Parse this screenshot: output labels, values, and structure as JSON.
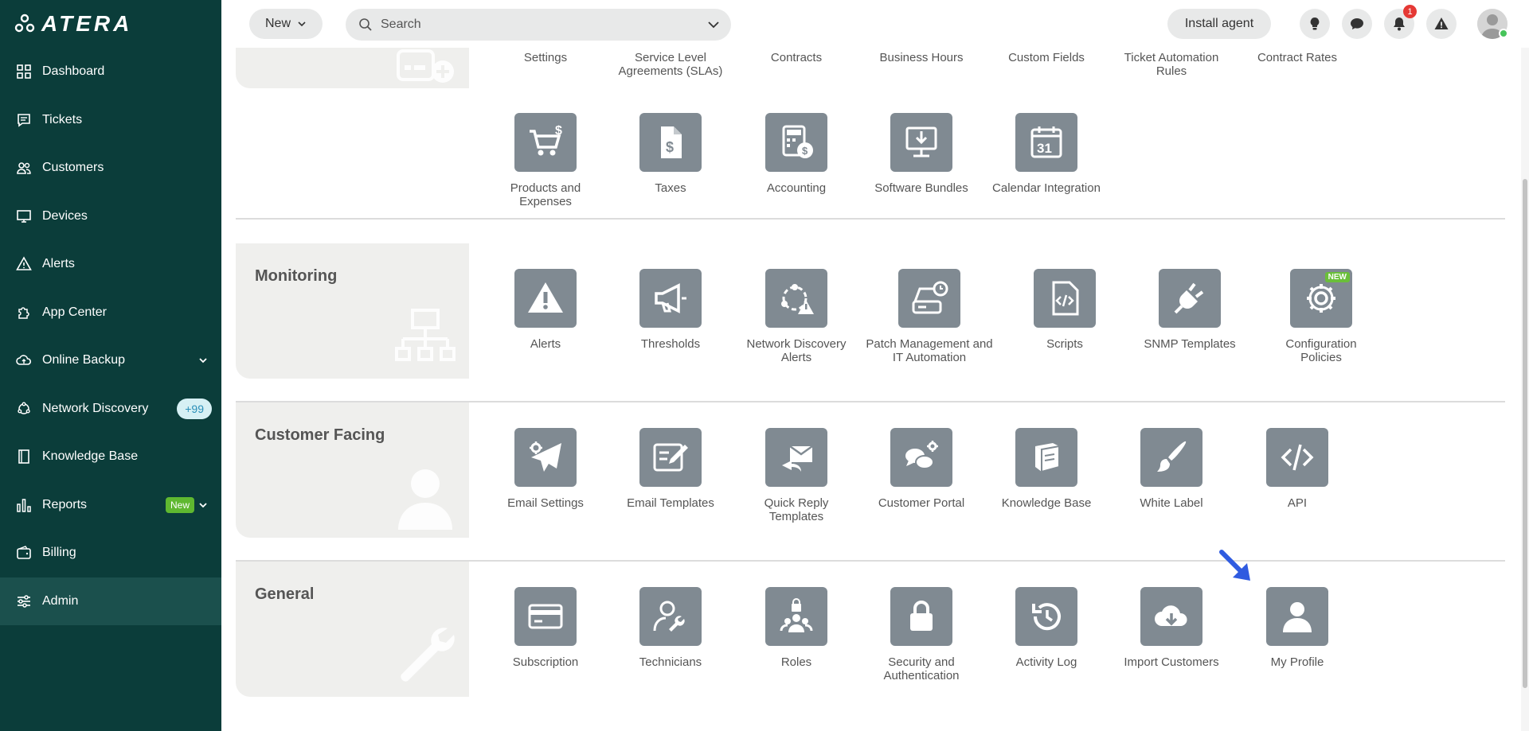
{
  "app": {
    "logo": "ATERA"
  },
  "sidebar": {
    "items": [
      {
        "label": "Dashboard",
        "icon": "dashboard-icon"
      },
      {
        "label": "Tickets",
        "icon": "ticket-icon"
      },
      {
        "label": "Customers",
        "icon": "users-icon"
      },
      {
        "label": "Devices",
        "icon": "monitor-icon"
      },
      {
        "label": "Alerts",
        "icon": "warning-icon"
      },
      {
        "label": "App Center",
        "icon": "puzzle-icon"
      },
      {
        "label": "Online Backup",
        "icon": "cloud-icon"
      },
      {
        "label": "Network Discovery",
        "icon": "network-icon",
        "badge": "+99"
      },
      {
        "label": "Knowledge Base",
        "icon": "book-icon"
      },
      {
        "label": "Reports",
        "icon": "bar-chart-icon",
        "badge": "New"
      },
      {
        "label": "Billing",
        "icon": "wallet-icon"
      },
      {
        "label": "Admin",
        "icon": "sliders-icon",
        "active": true
      }
    ]
  },
  "topbar": {
    "new_label": "New",
    "search_placeholder": "Search",
    "install_label": "Install agent",
    "notification_count": "1"
  },
  "sections": {
    "top_row": [
      "Settings",
      "Service Level Agreements (SLAs)",
      "Contracts",
      "Business Hours",
      "Custom Fields",
      "Ticket Automation Rules",
      "Contract Rates"
    ],
    "billing_row": [
      "Products and Expenses",
      "Taxes",
      "Accounting",
      "Software Bundles",
      "Calendar Integration"
    ],
    "monitoring": {
      "title": "Monitoring",
      "items": [
        "Alerts",
        "Thresholds",
        "Network Discovery Alerts",
        "Patch Management and IT Automation",
        "Scripts",
        "SNMP Templates",
        "Configuration Policies"
      ],
      "new_tag": "NEW"
    },
    "customer_facing": {
      "title": "Customer Facing",
      "items": [
        "Email Settings",
        "Email Templates",
        "Quick Reply Templates",
        "Customer Portal",
        "Knowledge Base",
        "White Label",
        "API"
      ]
    },
    "general": {
      "title": "General",
      "items": [
        "Subscription",
        "Technicians",
        "Roles",
        "Security and Authentication",
        "Activity Log",
        "Import Customers",
        "My Profile"
      ]
    }
  },
  "colors": {
    "sidebar_bg": "#0b3d3a",
    "tile_bg": "#808a92",
    "accent_arrow": "#2f5be0",
    "new_badge": "#5fb830"
  }
}
